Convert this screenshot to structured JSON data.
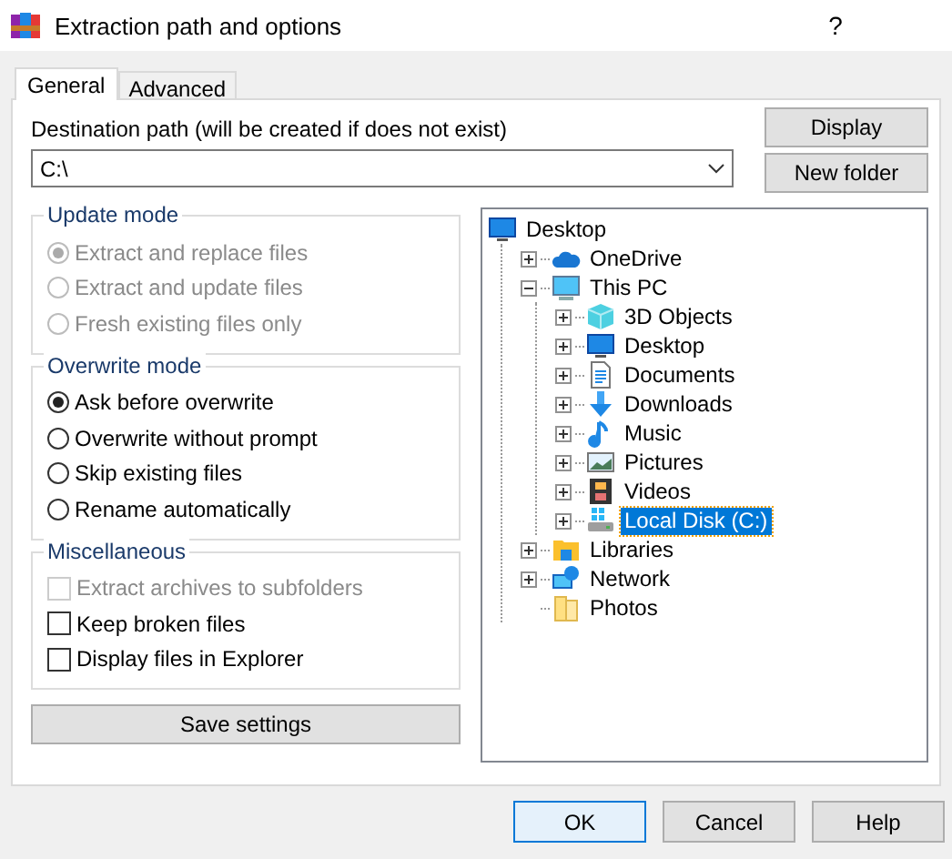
{
  "window": {
    "title": "Extraction path and options",
    "help_button": "?"
  },
  "tabs": [
    {
      "label": "General",
      "selected": true
    },
    {
      "label": "Advanced",
      "selected": false
    }
  ],
  "destination": {
    "label": "Destination path (will be created if does not exist)",
    "value": "C:\\"
  },
  "side_buttons": [
    "Display",
    "New folder"
  ],
  "update_mode": {
    "title": "Update mode",
    "options": [
      {
        "label": "Extract and replace files",
        "selected": true,
        "disabled": true
      },
      {
        "label": "Extract and update files",
        "selected": false,
        "disabled": true
      },
      {
        "label": "Fresh existing files only",
        "selected": false,
        "disabled": true
      }
    ]
  },
  "overwrite_mode": {
    "title": "Overwrite mode",
    "options": [
      {
        "label": "Ask before overwrite",
        "selected": true,
        "disabled": false
      },
      {
        "label": "Overwrite without prompt",
        "selected": false,
        "disabled": false
      },
      {
        "label": "Skip existing files",
        "selected": false,
        "disabled": false
      },
      {
        "label": "Rename automatically",
        "selected": false,
        "disabled": false
      }
    ]
  },
  "miscellaneous": {
    "title": "Miscellaneous",
    "options": [
      {
        "label": "Extract archives to subfolders",
        "checked": false,
        "disabled": true
      },
      {
        "label": "Keep broken files",
        "checked": false,
        "disabled": false
      },
      {
        "label": "Display files in Explorer",
        "checked": false,
        "disabled": false
      }
    ]
  },
  "save_button": "Save settings",
  "tree": [
    {
      "label": "Desktop",
      "kind": "desktop",
      "selected": false,
      "children": [
        {
          "label": "OneDrive",
          "kind": "cloud",
          "expandable": true,
          "expanded": false,
          "selected": false
        },
        {
          "label": "This PC",
          "kind": "pc",
          "expandable": true,
          "expanded": true,
          "selected": false,
          "children": [
            {
              "label": "3D Objects",
              "kind": "cube",
              "expandable": true,
              "expanded": false,
              "selected": false
            },
            {
              "label": "Desktop",
              "kind": "desktop",
              "expandable": true,
              "expanded": false,
              "selected": false
            },
            {
              "label": "Documents",
              "kind": "document",
              "expandable": true,
              "expanded": false,
              "selected": false
            },
            {
              "label": "Downloads",
              "kind": "download",
              "expandable": true,
              "expanded": false,
              "selected": false
            },
            {
              "label": "Music",
              "kind": "music",
              "expandable": true,
              "expanded": false,
              "selected": false
            },
            {
              "label": "Pictures",
              "kind": "image",
              "expandable": true,
              "expanded": false,
              "selected": false
            },
            {
              "label": "Videos",
              "kind": "film",
              "expandable": true,
              "expanded": false,
              "selected": false
            },
            {
              "label": "Local Disk (C:)",
              "kind": "drive",
              "expandable": true,
              "expanded": false,
              "selected": true
            }
          ]
        },
        {
          "label": "Libraries",
          "kind": "library",
          "expandable": true,
          "expanded": false,
          "selected": false
        },
        {
          "label": "Network",
          "kind": "network",
          "expandable": true,
          "expanded": false,
          "selected": false
        },
        {
          "label": "Photos",
          "kind": "folder",
          "selected": false
        }
      ]
    }
  ],
  "buttons": [
    {
      "label": "OK",
      "kind": "default"
    },
    {
      "label": "Cancel",
      "kind": "normal"
    },
    {
      "label": "Help",
      "kind": "normal"
    }
  ]
}
